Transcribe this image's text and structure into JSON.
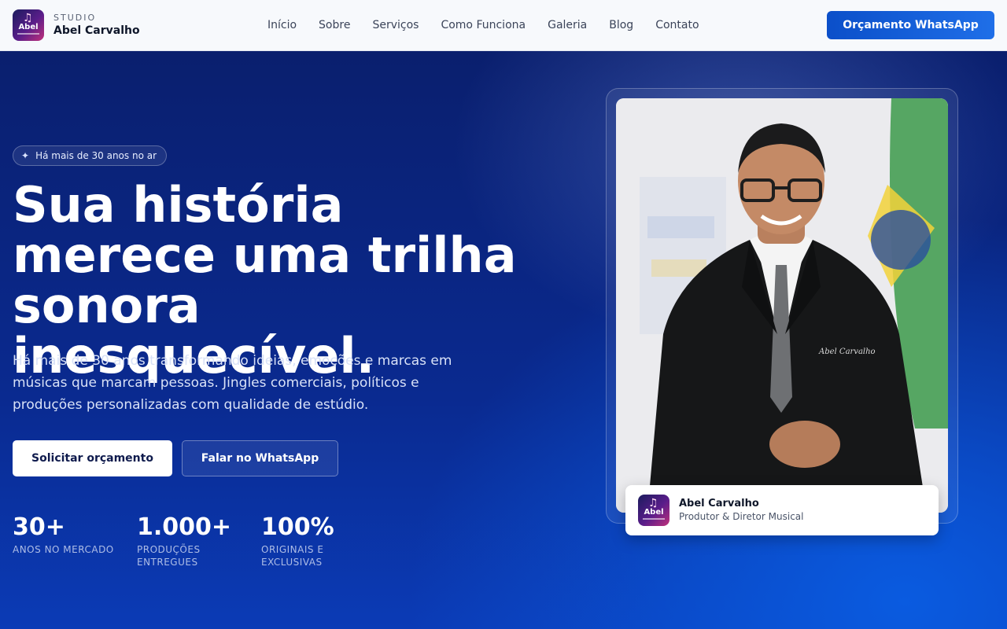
{
  "header": {
    "logo_word": "Abel",
    "brand_kicker": "STUDIO",
    "brand_name": "Abel Carvalho",
    "nav": [
      "Início",
      "Sobre",
      "Serviços",
      "Como Funciona",
      "Galeria",
      "Blog",
      "Contato"
    ],
    "cta_label": "Orçamento WhatsApp"
  },
  "hero": {
    "badge": "Há mais de 30 anos no ar",
    "headline": "Sua história merece uma trilha sonora inesquecível.",
    "lead": "Há mais de 30 anos transformando ideias, emoções e marcas em músicas que marcam pessoas. Jingles comerciais, políticos e produções personalizadas com qualidade de estúdio.",
    "primary_button": "Solicitar orçamento",
    "secondary_button": "Falar no WhatsApp",
    "stats": [
      {
        "value": "30+",
        "label": "ANOS NO MERCADO"
      },
      {
        "value": "1.000+",
        "label": "PRODUÇÕES ENTREGUES"
      },
      {
        "value": "100%",
        "label": "ORIGINAIS E EXCLUSIVAS"
      }
    ]
  },
  "profile": {
    "logo_word": "Abel",
    "name": "Abel Carvalho",
    "role": "Produtor & Diretor Musical",
    "suit_signature": "Abel Carvalho"
  },
  "colors": {
    "brand_blue": "#0b4fc9",
    "hero_dark": "#0a1f6e",
    "hero_bright": "#0a5be0"
  }
}
